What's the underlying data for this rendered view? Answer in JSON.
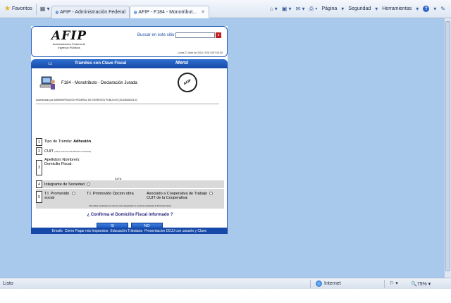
{
  "browser": {
    "favorites_label": "Favoritos",
    "tabs": [
      {
        "title": "AFIP - Administración Federal"
      },
      {
        "title": "AFIP - F184 - Monotribut..."
      }
    ],
    "tools": {
      "page": "Página",
      "security": "Seguridad",
      "tools": "Herramientas"
    },
    "status": {
      "ready": "Listo",
      "zone": "Internet",
      "zoom": "75%"
    }
  },
  "header": {
    "logo_text": "AFIP",
    "logo_sub1": "Administración Federal de",
    "logo_sub2": "Ingresos Públicos",
    "search_label": "Buscar en este sitio",
    "date": "Lunes 27 Abril de 2016 19:33 GMT-03:00"
  },
  "band": {
    "title": "Trámites con Clave Fiscal",
    "menu": "Menú"
  },
  "form": {
    "title": "F184 - Monotributo - Declaración Jurada",
    "seal_text": "AFIP",
    "authenticated": "Autenticado por ADMINISTRACION FEDERAL DE INGRESOS PUBLICOS (33-69345023-9)",
    "rows": [
      {
        "num": "1",
        "label": "Tipo de Trámite:",
        "value": "Adhesión"
      },
      {
        "num": "2",
        "label": "CUIT",
        "small": "(clave única de identificación tributaria)"
      },
      {
        "num": "3",
        "label": "Apellido/s Nombre/s:",
        "label2": "Domicilio Fiscal:"
      },
      {
        "num": "4",
        "label": "Integrante de Sociedad"
      },
      {
        "num": "5",
        "label_a": "T.I. Promovido",
        "label_a2": "social",
        "label_b": "T.I. Promovido Opcion obra",
        "label_c": "Asociado a Cooperativa de Trabajo",
        "label_c2": "CUIT de la Cooperativa:"
      }
    ],
    "alta_text": "ALTA",
    "note": "Sólo debes completarse en caso de estar categorizado en una de las categorías de Personas Físicas",
    "confirm_question": "¿ Confirma el Domicilio Fiscal informado ?",
    "yes_label": "SI",
    "no_label": "NO"
  },
  "footer": {
    "links": [
      "Emails",
      "Cómo Pagar mis Impuestos",
      "Educación Tributaria",
      "Presentacion DDJJ con usuario y Clave"
    ]
  }
}
